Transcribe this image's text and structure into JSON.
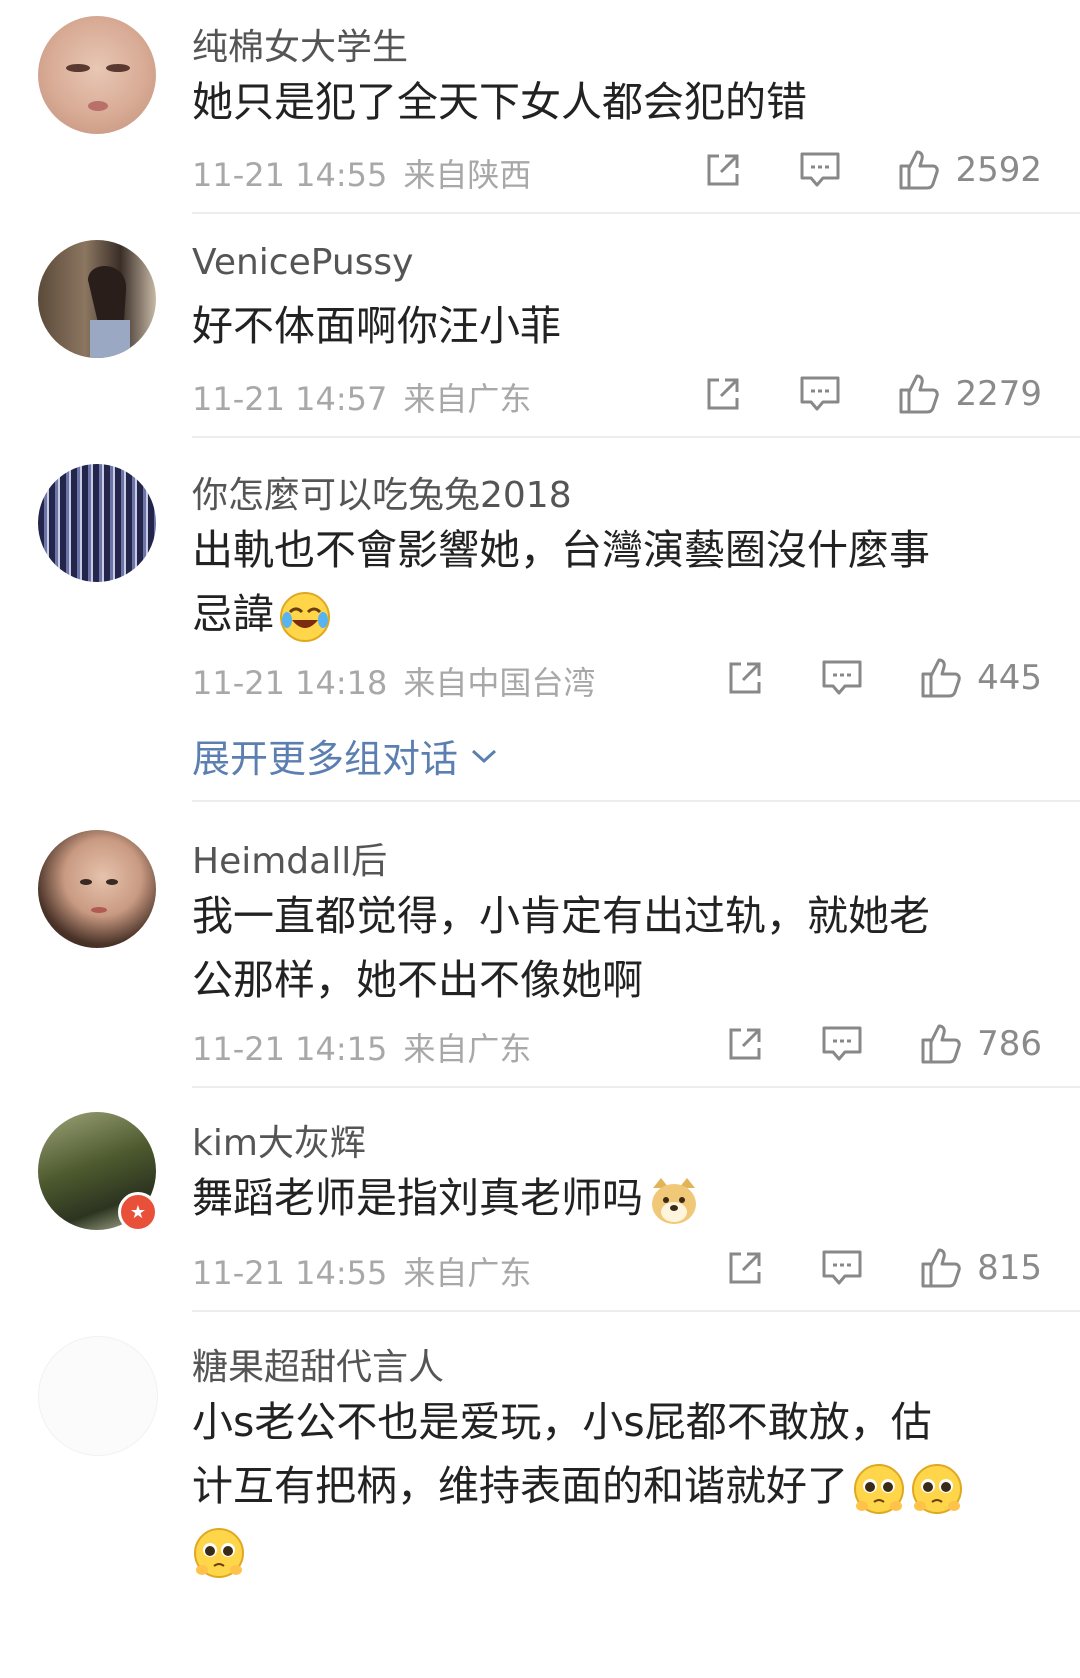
{
  "comments": [
    {
      "username": "纯棉女大学生",
      "text": "她只是犯了全天下女人都会犯的错",
      "time": "11-21 14:55",
      "location": "来自陕西",
      "likes": "2592"
    },
    {
      "username": "VenicePussy",
      "text": "好不体面啊你汪小菲",
      "time": "11-21 14:57",
      "location": "来自广东",
      "likes": "2279"
    },
    {
      "username": "你怎麼可以吃兔兔2018",
      "text_line1": "出軌也不會影響她，台灣演藝圈沒什麼事",
      "text_line2": "忌諱",
      "time": "11-21 14:18",
      "location": "来自中国台湾",
      "likes": "445",
      "expand_label": "展开更多组对话"
    },
    {
      "username": "Heimdall后",
      "text_line1": "我一直都觉得，小肯定有出过轨，就她老",
      "text_line2": "公那样，她不出不像她啊",
      "time": "11-21 14:15",
      "location": "来自广东",
      "likes": "786"
    },
    {
      "username": "kim大灰辉",
      "text": "舞蹈老师是指刘真老师吗",
      "time": "11-21 14:55",
      "location": "来自广东",
      "likes": "815"
    },
    {
      "username": "糖果超甜代言人",
      "text_line1": "小s老公不也是爱玩，小s屁都不敢放，估",
      "text_line2": "计互有把柄，维持表面的和谐就好了"
    }
  ],
  "icons": {
    "share": "share-icon",
    "reply": "comment-icon",
    "like": "thumbs-up-icon",
    "expand": "chevron-down-icon",
    "emoji_laugh": "laughing-crying-emoji-icon",
    "emoji_doge": "doge-emoji-icon",
    "emoji_pleading": "pleading-emoji-icon",
    "badge": "verified-badge-icon"
  },
  "colors": {
    "link": "#5b7fb0",
    "badge": "#e8503a"
  }
}
